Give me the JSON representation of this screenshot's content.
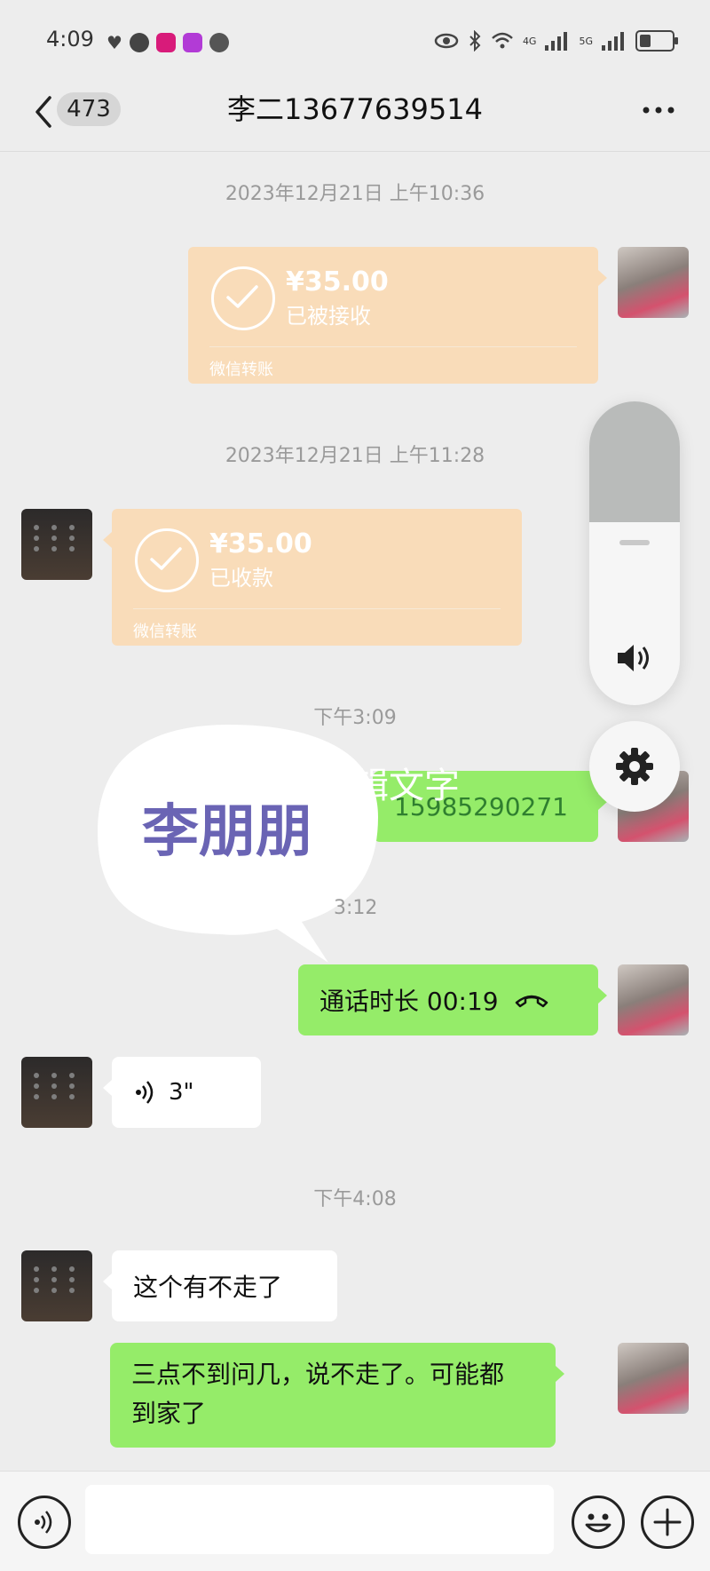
{
  "status_bar": {
    "time": "4:09",
    "network_1": "4G",
    "network_2": "5G",
    "battery_level": 0.4
  },
  "nav": {
    "unread_count": "473",
    "title": "李二13677639514"
  },
  "messages": {
    "ts1": "2023年12月21日 上午10:36",
    "transfer_sent": {
      "amount": "¥35.00",
      "status": "已被接收",
      "footer": "微信转账"
    },
    "ts2": "2023年12月21日 上午11:28",
    "transfer_received": {
      "amount": "¥35.00",
      "status": "已收款",
      "footer": "微信转账"
    },
    "ts3": "下午3:09",
    "phone_msg": "15985290271",
    "ts4": "3:12",
    "call_msg": "通话时长 00:19",
    "voice_duration": "3\"",
    "ts5": "下午4:08",
    "text_received": "这个有不走了",
    "text_sent_line1": "三点不到问几，说不走了。可能都",
    "text_sent_line2": "到家了"
  },
  "overlay": {
    "sticker_text": "李朋朋",
    "edit_text_partial": "辑文字",
    "volume_level": 0.6
  },
  "colors": {
    "bubble_green": "#95ec69",
    "transfer_orange": "#f9dcb9",
    "background": "#ededed",
    "sticker_purple": "#6a64b4"
  },
  "icons": [
    "back-icon",
    "more-icon",
    "check-icon",
    "volume-icon",
    "gear-icon",
    "phone-hangup-icon",
    "voice-icon",
    "emoji-icon",
    "plus-icon"
  ]
}
